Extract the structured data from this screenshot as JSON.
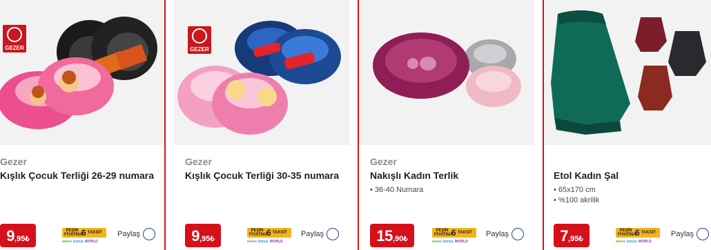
{
  "products": [
    {
      "brand": "Gezer",
      "title": "Kışlık Çocuk Terliği 26-29 numara",
      "features": [],
      "price_int": "9",
      "price_dec": ",95",
      "currency": "₺",
      "image": "kids-slippers-princess-and-car",
      "logo_text": "GEZER"
    },
    {
      "brand": "Gezer",
      "title": "Kışlık Çocuk Terliği 30-35 numara",
      "features": [],
      "price_int": "9",
      "price_dec": ",95",
      "currency": "₺",
      "image": "kids-slippers-princess-and-race-car",
      "logo_text": "GEZER"
    },
    {
      "brand": "Gezer",
      "title": "Nakışlı Kadın Terlik",
      "features": [
        "36-40 Numara"
      ],
      "price_int": "15",
      "price_dec": ",90",
      "currency": "₺",
      "image": "women-embroidered-slippers"
    },
    {
      "brand": "",
      "title": "Etol Kadın Şal",
      "features": [
        "65x170 cm",
        "%100 akrilik"
      ],
      "price_int": "7",
      "price_dec": ",95",
      "currency": "₺",
      "image": "women-shawls"
    }
  ],
  "taksit": {
    "pesin_line1": "PEŞİN",
    "pesin_line2": "FİYATINA",
    "count": "6",
    "word": "TAKSİT",
    "card1": "axess",
    "card2": "bonus",
    "card3": "WORLD"
  },
  "share_label": "Paylaş",
  "colors": {
    "accent_red": "#d6101b",
    "taksit_orange": "#f6b21b",
    "share_ring": "#2a3f8f"
  }
}
